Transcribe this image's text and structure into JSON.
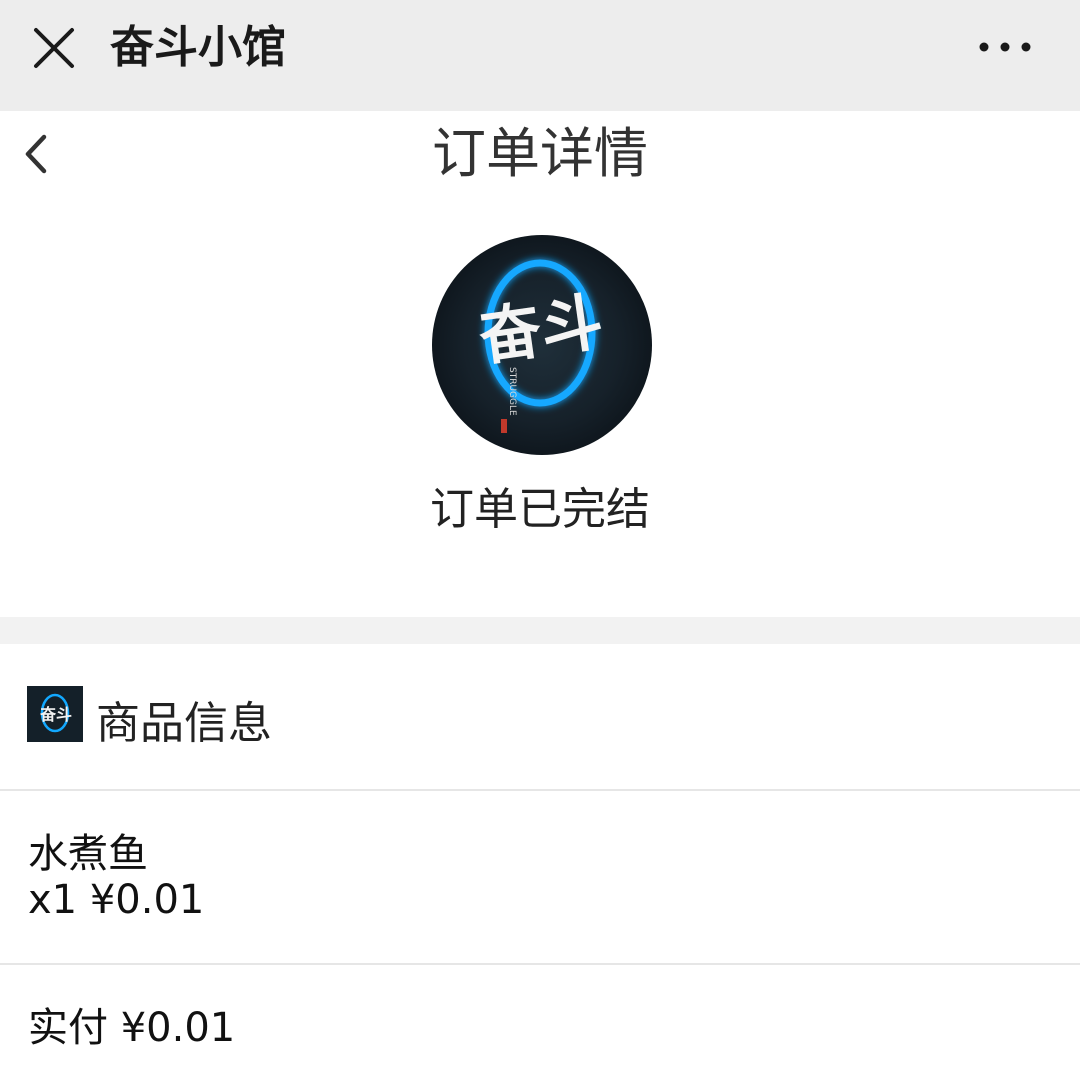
{
  "topbar": {
    "close_icon": "close-icon",
    "app_title": "奋斗小馆",
    "more_icon": "more-icon"
  },
  "header": {
    "back_icon": "chevron-left-icon",
    "title": "订单详情"
  },
  "order": {
    "status": "订单已完结",
    "logo_icon": "store-logo",
    "logo_text": "奋斗",
    "logo_subtext": "STRUGGLE",
    "accent_color": "#12a8ff"
  },
  "product_section": {
    "title": "商品信息",
    "items": [
      {
        "name": "水煮鱼",
        "quantity_price": "x1 ¥0.01"
      }
    ]
  },
  "payment": {
    "paid_text": "实付 ¥0.01"
  }
}
